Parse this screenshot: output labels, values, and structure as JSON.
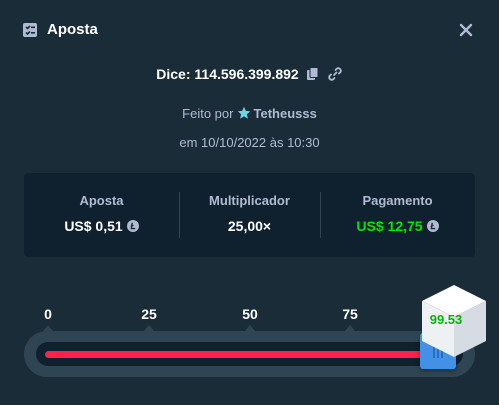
{
  "header": {
    "title": "Aposta",
    "title_icon": "bet-slip-icon",
    "close_icon": "close-icon"
  },
  "dice": {
    "text": "Dice: 114.596.399.892",
    "copy_icon": "copy-icon",
    "link_icon": "link-icon"
  },
  "made_by": {
    "prefix": "Feito por",
    "username": "Tetheusss",
    "vip_icon": "star-icon"
  },
  "date": "em 10/10/2022 às 10:30",
  "stats": {
    "bet": {
      "label": "Aposta",
      "value": "US$ 0,51"
    },
    "multiplier": {
      "label": "Multiplicador",
      "value": "25,00×"
    },
    "payout": {
      "label": "Pagamento",
      "value": "US$ 12,75"
    },
    "currency_icon": "litecoin-icon"
  },
  "slider": {
    "ticks": [
      "0",
      "25",
      "50",
      "75"
    ],
    "value": 96,
    "min": 0,
    "max": 100,
    "roll_result": "99.53"
  },
  "colors": {
    "background": "#1a2c38",
    "panel": "#0f212e",
    "muted_text": "#b1bad3",
    "payout_green": "#00e701",
    "lose_red": "#ff1f4b",
    "handle_blue": "#4391e7"
  }
}
